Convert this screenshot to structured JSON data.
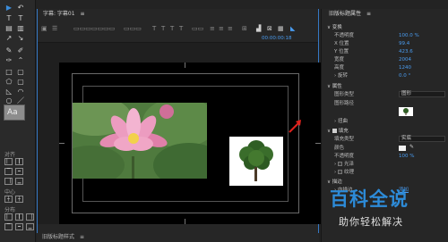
{
  "tools": {
    "section_a": "对齐",
    "section_b": "中心",
    "section_c": "分布",
    "swatch_text": "Aa"
  },
  "center": {
    "tab_title": "字幕: 字幕01",
    "timecode": "00:00:00:18"
  },
  "bottom": {
    "panel_title": "旧版标题样式"
  },
  "props": {
    "title": "旧版标题属性",
    "rows": {
      "transform": "变换",
      "opacity_label": "不透明度",
      "opacity_val": "100.0 %",
      "x_label": "X 位置",
      "x_val": "99.4",
      "y_label": "Y 位置",
      "y_val": "423.6",
      "width_label": "宽度",
      "width_val": "2004",
      "height_label": "高度",
      "height_val": "1240",
      "rotation_label": "旋转",
      "rotation_val": "0.0 °",
      "properties": "属性",
      "gtype_label": "图形类型",
      "gtype_val": "图形",
      "gpath_label": "图形路径",
      "distort": "扭曲",
      "fill": "填充",
      "filltype_label": "填充类型",
      "filltype_val": "实底",
      "color_label": "颜色",
      "fopacity_label": "不透明度",
      "fopacity_val": "100 %",
      "sheen": "光泽",
      "texture": "纹理",
      "stroke": "描边",
      "inner_label": "内描边",
      "inner_add": "添加"
    }
  },
  "watermark": {
    "logo": "百科全说",
    "sub": "助你轻松解决"
  }
}
